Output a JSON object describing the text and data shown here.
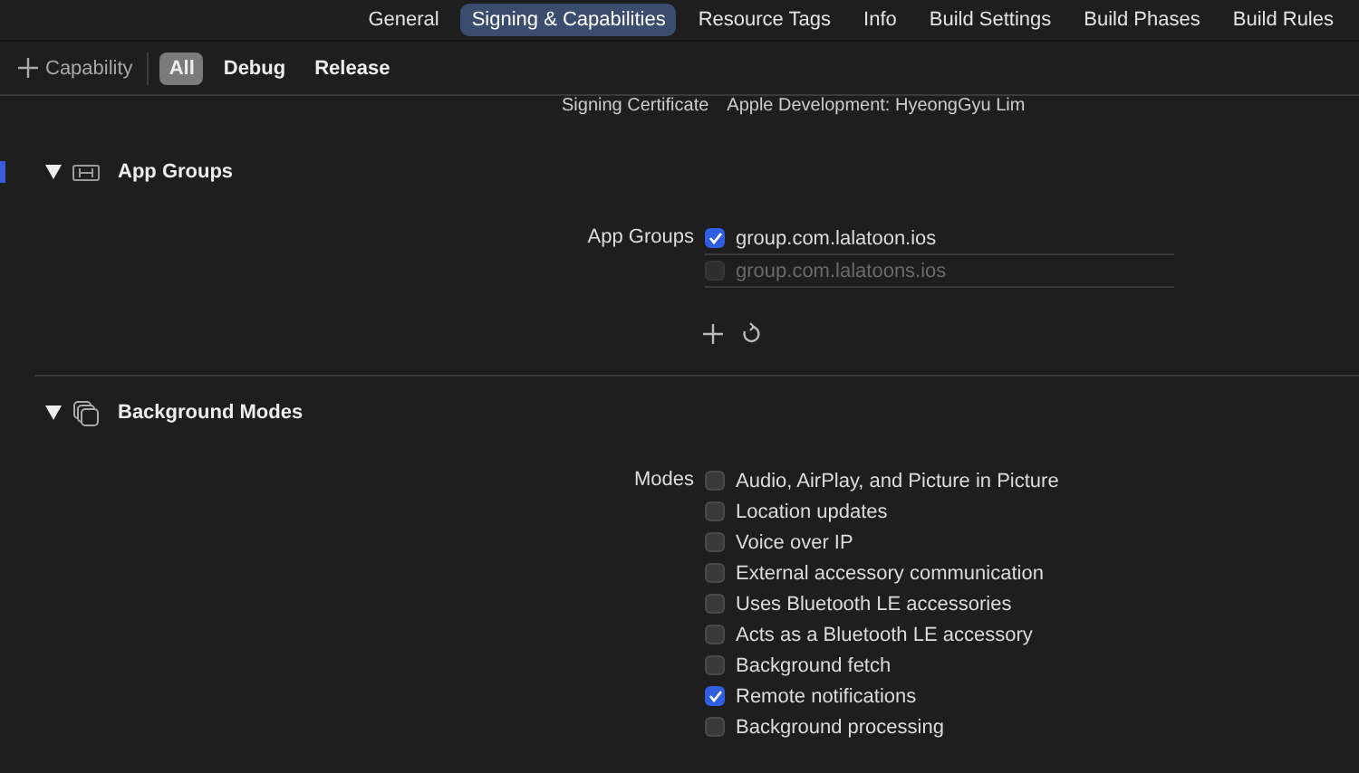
{
  "tabs": [
    {
      "label": "General",
      "selected": false
    },
    {
      "label": "Signing & Capabilities",
      "selected": true
    },
    {
      "label": "Resource Tags",
      "selected": false
    },
    {
      "label": "Info",
      "selected": false
    },
    {
      "label": "Build Settings",
      "selected": false
    },
    {
      "label": "Build Phases",
      "selected": false
    },
    {
      "label": "Build Rules",
      "selected": false
    }
  ],
  "toolbar": {
    "add_label": "Capability",
    "filters": [
      {
        "label": "All",
        "selected": true
      },
      {
        "label": "Debug",
        "selected": false
      },
      {
        "label": "Release",
        "selected": false
      }
    ]
  },
  "signing_row": {
    "label": "Signing Certificate",
    "value": "Apple Development: HyeongGyu Lim"
  },
  "sections": [
    {
      "kind": "groups",
      "title": "App Groups",
      "expanded": true,
      "field_label": "App Groups",
      "items": [
        {
          "label": "group.com.lalatoon.ios",
          "checked": true
        },
        {
          "label": "group.com.lalatoons.ios",
          "checked": false
        }
      ]
    },
    {
      "kind": "modes",
      "title": "Background Modes",
      "expanded": true,
      "field_label": "Modes",
      "items": [
        {
          "label": "Audio, AirPlay, and Picture in Picture",
          "checked": false
        },
        {
          "label": "Location updates",
          "checked": false
        },
        {
          "label": "Voice over IP",
          "checked": false
        },
        {
          "label": "External accessory communication",
          "checked": false
        },
        {
          "label": "Uses Bluetooth LE accessories",
          "checked": false
        },
        {
          "label": "Acts as a Bluetooth LE accessory",
          "checked": false
        },
        {
          "label": "Background fetch",
          "checked": false
        },
        {
          "label": "Remote notifications",
          "checked": true
        },
        {
          "label": "Background processing",
          "checked": false
        }
      ]
    }
  ]
}
